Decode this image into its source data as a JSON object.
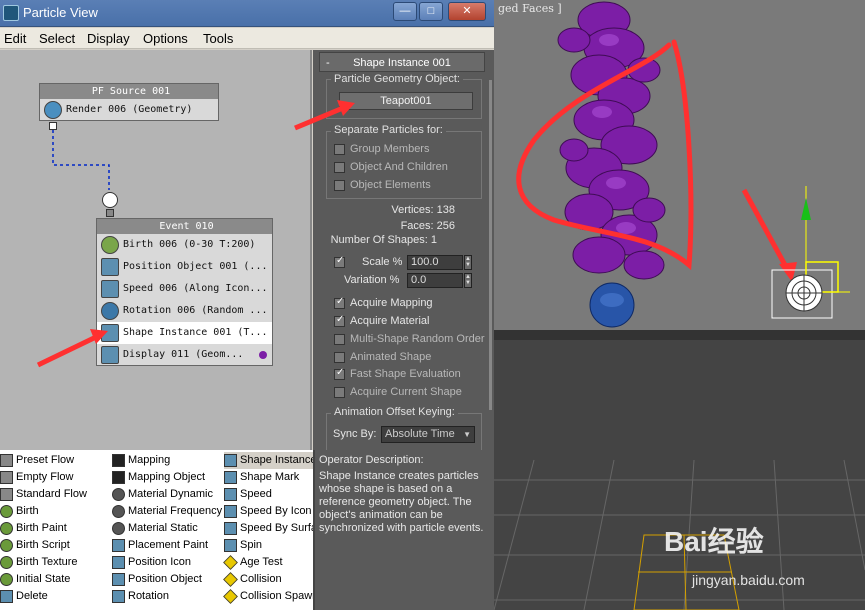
{
  "window": {
    "title": "Particle View",
    "minimize": "—",
    "maximize": "□",
    "close": "✕"
  },
  "menu": [
    "Edit",
    "Select",
    "Display",
    "Options",
    "Tools"
  ],
  "viewport": {
    "label": "ged Faces ]"
  },
  "graph": {
    "source_node": {
      "title": "PF Source 001",
      "rows": [
        "Render 006 (Geometry)"
      ]
    },
    "event_node": {
      "title": "Event 010",
      "rows": [
        "Birth 006 (0-30 T:200)",
        "Position Object 001 (...",
        "Speed 006 (Along Icon...",
        "Rotation 006 (Random ...",
        "Shape Instance 001 (T...",
        "Display 011 (Geom..."
      ],
      "selected_index": 4
    }
  },
  "params": {
    "rollout_title": "Shape Instance 001",
    "rollout_collapse": "-",
    "geometry_group": "Particle Geometry Object:",
    "geometry_button": "Teapot001",
    "separate_group": "Separate Particles for:",
    "separate_options": [
      {
        "label": "Group Members",
        "checked": false
      },
      {
        "label": "Object And Children",
        "checked": false
      },
      {
        "label": "Object Elements",
        "checked": false
      }
    ],
    "vertices_label": "Vertices: 138",
    "faces_label": "Faces: 256",
    "shapes_label": "Number Of Shapes: 1",
    "scale_label": "Scale %",
    "scale_value": "100.0",
    "scale_checked": true,
    "variation_label": "Variation %",
    "variation_value": "0.0",
    "options": [
      {
        "label": "Acquire Mapping",
        "checked": true
      },
      {
        "label": "Acquire Material",
        "checked": true
      },
      {
        "label": "Multi-Shape Random Order",
        "checked": false
      },
      {
        "label": "Animated Shape",
        "checked": false
      },
      {
        "label": "Fast Shape Evaluation",
        "checked": true
      },
      {
        "label": "Acquire Current Shape",
        "checked": false
      }
    ],
    "offset_group": "Animation Offset Keying:",
    "sync_label": "Sync By:",
    "sync_value": "Absolute Time"
  },
  "depot": {
    "col1": [
      "Preset Flow",
      "Empty Flow",
      "Standard Flow",
      "Birth",
      "Birth Paint",
      "Birth Script",
      "Birth Texture",
      "Initial State",
      "Delete"
    ],
    "col2": [
      "Mapping",
      "Mapping Object",
      "Material Dynamic",
      "Material Frequency",
      "Material Static",
      "Placement Paint",
      "Position Icon",
      "Position Object",
      "Rotation"
    ],
    "col3": [
      "Shape Instance",
      "Shape Mark",
      "Speed",
      "Speed By Icon",
      "Speed By Surfa",
      "Spin",
      "Age Test",
      "Collision",
      "Collision Spawn"
    ]
  },
  "description": {
    "title": "Operator Description:",
    "text": "Shape Instance creates particles whose shape is based on a reference geometry object. The object's animation can be synchronized with particle events."
  },
  "watermark": {
    "brand": "Bai经验",
    "url": "jingyan.baidu.com"
  },
  "colors": {
    "annotation": "#ff3030",
    "particles": "#8a1fb0",
    "title_bar": "#4f75ae"
  }
}
